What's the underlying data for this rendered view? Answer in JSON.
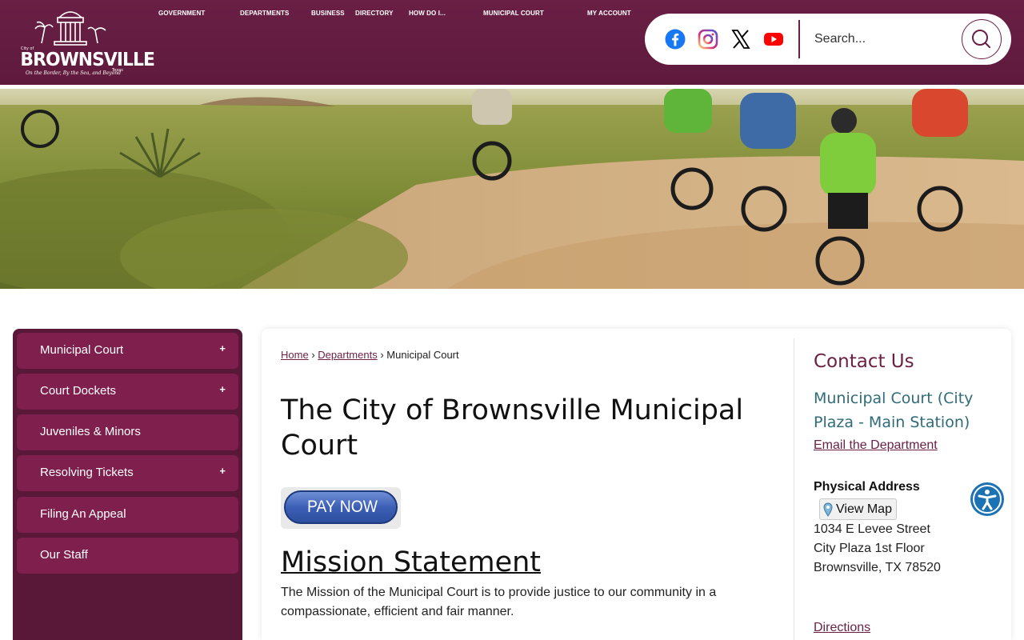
{
  "header": {
    "logo": {
      "city": "BROWNSVILLE",
      "small_city_of": "City of",
      "small_texas": "Texas",
      "tagline": "On the Border, By the Sea, and Beyond"
    },
    "nav": [
      {
        "label": "GOVERNMENT"
      },
      {
        "label": "DEPARTMENTS"
      },
      {
        "label": "BUSINESS"
      },
      {
        "label": "DIRECTORY"
      },
      {
        "label": "HOW DO I..."
      },
      {
        "label": "MUNICIPAL COURT"
      },
      {
        "label": "MY ACCOUNT"
      }
    ],
    "social": [
      {
        "icon": "facebook-icon",
        "color": "#1877f2"
      },
      {
        "icon": "instagram-icon",
        "color": "#d62976"
      },
      {
        "icon": "x-icon",
        "color": "#000000"
      },
      {
        "icon": "youtube-icon",
        "color": "#ff0000"
      }
    ],
    "search": {
      "placeholder": "Search...",
      "icon": "search-icon"
    }
  },
  "sidebar": {
    "items": [
      {
        "label": "Municipal Court",
        "expandable": "+"
      },
      {
        "label": "Court Dockets",
        "expandable": "+"
      },
      {
        "label": "Juveniles & Minors",
        "expandable": ""
      },
      {
        "label": "Resolving Tickets",
        "expandable": "+"
      },
      {
        "label": "Filing An Appeal",
        "expandable": ""
      },
      {
        "label": "Our Staff",
        "expandable": ""
      }
    ]
  },
  "main": {
    "breadcrumb": {
      "home": "Home",
      "sep1": "›",
      "departments": "Departments",
      "sep2": "›",
      "current": "Municipal Court"
    },
    "title": "The City of Brownsville Municipal Court",
    "pay_now": "PAY NOW",
    "mission_heading": "Mission Statement",
    "mission_text": "The Mission of the Municipal Court is to provide justice to our community in a compassionate, efficient and fair manner."
  },
  "contact": {
    "heading": "Contact Us",
    "department": "Municipal Court (City Plaza - Main Station)",
    "email_link": "Email the Department",
    "address_heading": "Physical Address",
    "view_map": "View Map",
    "address_line1": "1034 E Levee Street",
    "address_line2": "City Plaza 1st Floor",
    "address_line3": "Brownsville, TX 78520",
    "directions": "Directions"
  },
  "colors": {
    "brand_maroon": "#6a1f45",
    "sidebar_item": "#7e1f4d",
    "contact_teal": "#2f6b78",
    "accessibility_blue": "#1c73b4"
  }
}
